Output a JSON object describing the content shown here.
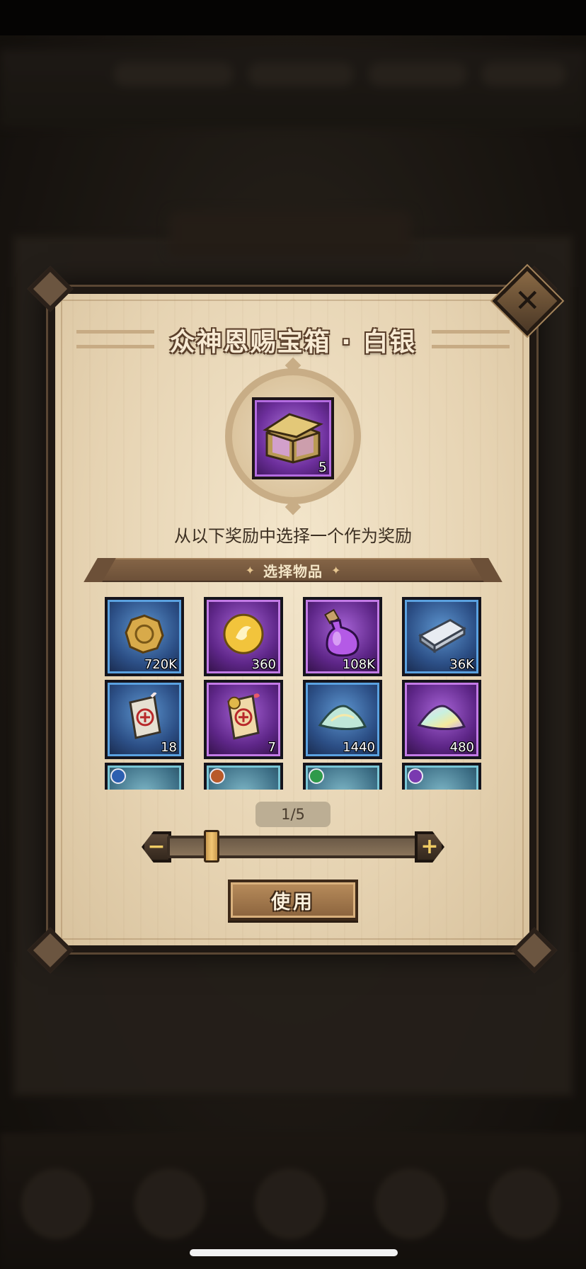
{
  "dialog": {
    "title": "众神恩赐宝箱 · 白银",
    "chest": {
      "icon": "silver-chest-icon",
      "count": "5"
    },
    "instruction": "从以下奖励中选择一个作为奖励",
    "section_label": "选择物品",
    "items": [
      {
        "icon": "gold-coin-icon",
        "qty": "720K",
        "rarity": "blue"
      },
      {
        "icon": "golden-orb-icon",
        "qty": "360",
        "rarity": "purple"
      },
      {
        "icon": "purple-potion-icon",
        "qty": "108K",
        "rarity": "purple"
      },
      {
        "icon": "silver-ingot-icon",
        "qty": "36K",
        "rarity": "blue"
      },
      {
        "icon": "red-scroll-icon",
        "qty": "18",
        "rarity": "blue"
      },
      {
        "icon": "gold-scroll-icon",
        "qty": "7",
        "rarity": "purple"
      },
      {
        "icon": "crystal-shard-icon",
        "qty": "1440",
        "rarity": "blue"
      },
      {
        "icon": "rainbow-crystal-icon",
        "qty": "480",
        "rarity": "purple"
      },
      {
        "icon": "mountain-icon",
        "qty": "",
        "rarity": "teal"
      },
      {
        "icon": "mountain-icon",
        "qty": "",
        "rarity": "teal"
      },
      {
        "icon": "mountain-icon",
        "qty": "",
        "rarity": "teal"
      },
      {
        "icon": "mountain-icon",
        "qty": "",
        "rarity": "teal"
      }
    ],
    "page_indicator": "1/5",
    "slider": {
      "min_label": "−",
      "max_label": "+",
      "value_fraction": 0.25
    },
    "use_button": "使用",
    "close_label": "✕"
  },
  "colors": {
    "blue_rarity": "#2c4f86",
    "purple_rarity": "#5e2688",
    "parchment": "#e6d3b2",
    "accent_gold": "#f0cc64"
  }
}
